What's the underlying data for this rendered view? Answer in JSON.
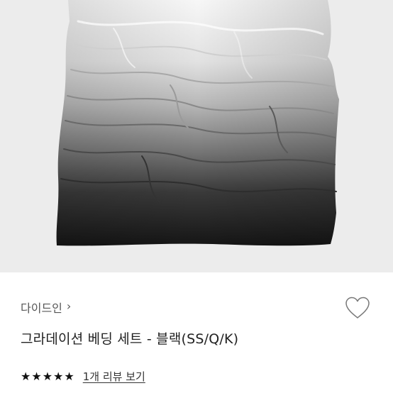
{
  "product": {
    "image_icon": "gradient-duvet-photo",
    "brand": "다이드인",
    "brand_chevron": "›",
    "title": "그라데이션 베딩 세트 - 블랙(SS/Q/K)",
    "rating": {
      "stars_filled": 5,
      "stars_total": 5,
      "star_glyph": "★",
      "review_link": "1개 리뷰 보기"
    },
    "wishlist_icon": "heart-outline-icon"
  },
  "colors": {
    "image_background": "#ececec",
    "text_primary": "#222222",
    "text_secondary": "#555555",
    "star": "#111111"
  }
}
